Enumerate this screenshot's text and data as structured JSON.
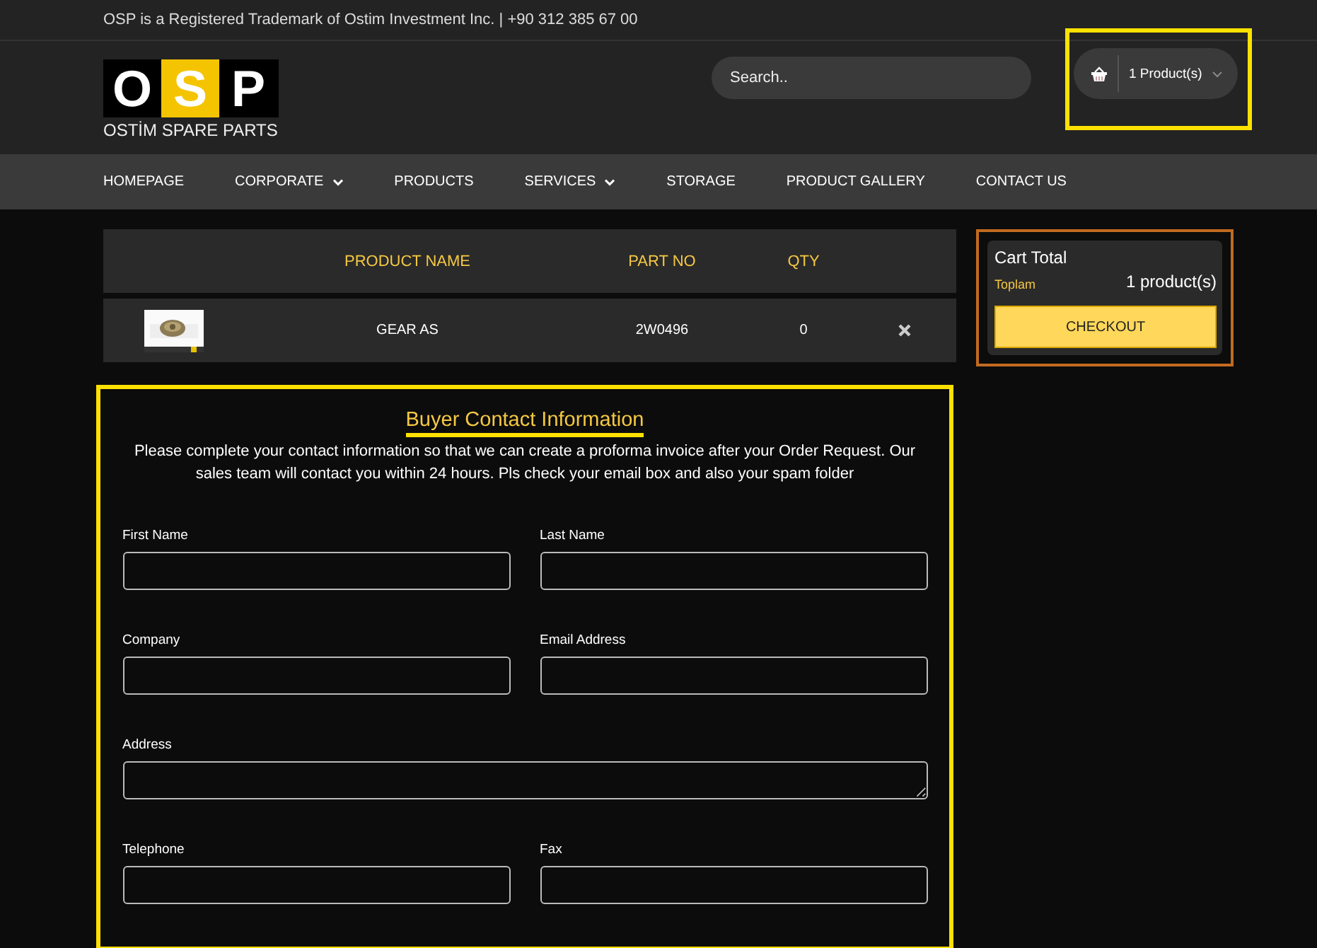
{
  "topbar": {
    "text": "OSP is a Registered Trademark of Ostim Investment Inc. | +90 312 385 67 00"
  },
  "logo": {
    "letters": [
      {
        "text": "O",
        "highlighted": false
      },
      {
        "text": "S",
        "highlighted": true
      },
      {
        "text": "P",
        "highlighted": false
      }
    ],
    "tagline": "OSTİM SPARE PARTS"
  },
  "search": {
    "placeholder": "Search.."
  },
  "cart_button": {
    "label": "1 Product(s)",
    "annotated": true
  },
  "nav": [
    {
      "label": "HOMEPAGE",
      "has_dropdown": false
    },
    {
      "label": "CORPORATE",
      "has_dropdown": true
    },
    {
      "label": "PRODUCTS",
      "has_dropdown": false
    },
    {
      "label": "SERVICES",
      "has_dropdown": true
    },
    {
      "label": "STORAGE",
      "has_dropdown": false
    },
    {
      "label": "PRODUCT GALLERY",
      "has_dropdown": false
    },
    {
      "label": "CONTACT US",
      "has_dropdown": false
    }
  ],
  "table": {
    "columns": [
      "PRODUCT NAME",
      "PART NO",
      "QTY"
    ],
    "rows": [
      {
        "product_name": "GEAR AS",
        "part_no": "2W0496",
        "qty": "0"
      }
    ]
  },
  "cart_total": {
    "title": "Cart Total",
    "label": "Toplam",
    "value": "1 product(s)",
    "button": "CHECKOUT",
    "annotated": true
  },
  "form": {
    "title": "Buyer Contact Information",
    "intro": "Please complete your contact information so that we can create a proforma invoice after your Order Request. Our sales team will contact you within 24 hours. Pls check your email box and also your spam folder",
    "annotated": true,
    "fields": [
      {
        "label": "First Name",
        "kind": "input"
      },
      {
        "label": "Last Name",
        "kind": "input"
      },
      {
        "label": "Company",
        "kind": "input"
      },
      {
        "label": "Email Address",
        "kind": "input"
      },
      {
        "label": "Address",
        "kind": "textarea"
      },
      {
        "label": "Telephone",
        "kind": "input"
      },
      {
        "label": "Fax",
        "kind": "input"
      }
    ]
  }
}
